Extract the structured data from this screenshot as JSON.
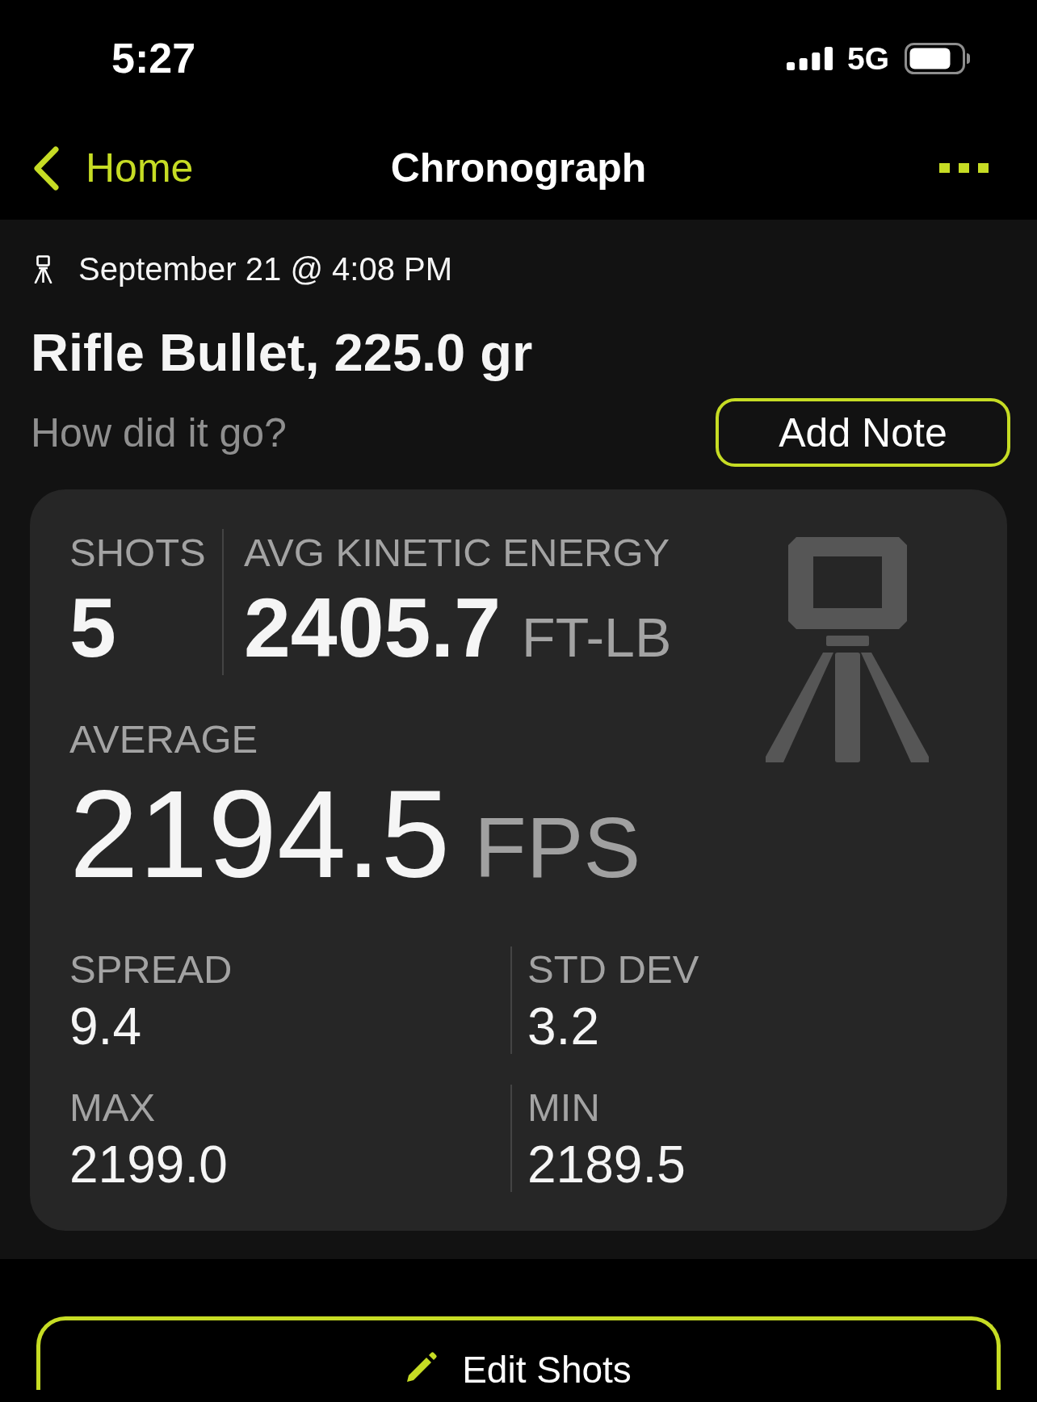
{
  "status_bar": {
    "time": "5:27",
    "network": "5G"
  },
  "nav_bar": {
    "back_label": "Home",
    "title": "Chronograph"
  },
  "session": {
    "date": "September 21 @ 4:08 PM",
    "title": "Rifle Bullet, 225.0 gr",
    "note_prompt": "How did it go?",
    "add_note_button": "Add Note"
  },
  "summary_card": {
    "shots": {
      "label": "SHOTS",
      "value": "5"
    },
    "kinetic_energy": {
      "label": "AVG KINETIC ENERGY",
      "value": "2405.7",
      "unit": "FT-LB"
    },
    "average": {
      "label": "AVERAGE",
      "value": "2194.5",
      "unit": "FPS"
    },
    "stats": [
      {
        "label": "SPREAD",
        "value": "9.4"
      },
      {
        "label": "STD DEV",
        "value": "3.2"
      },
      {
        "label": "MAX",
        "value": "2199.0"
      },
      {
        "label": "MIN",
        "value": "2189.5"
      }
    ]
  },
  "edit_shots_button": "Edit Shots"
}
